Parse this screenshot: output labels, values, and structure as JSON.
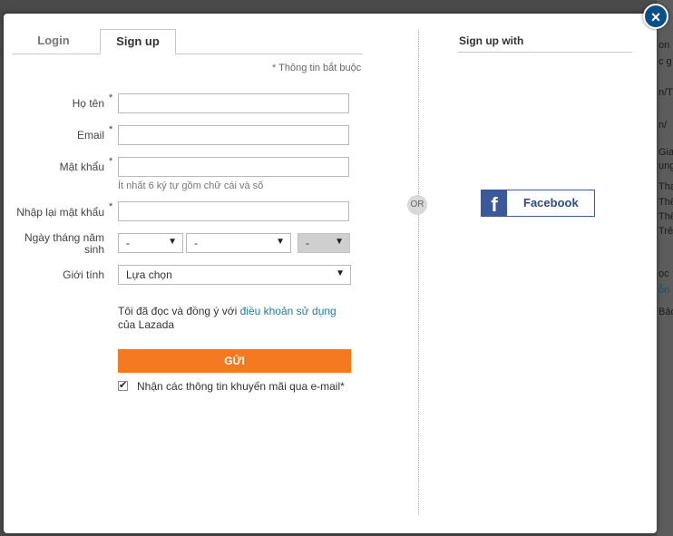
{
  "background": {
    "right_snippets": [
      "on",
      "c g",
      "n/T",
      "n/",
      "Gia",
      "ụng",
      "Tha",
      "Thể",
      "Thể",
      "Trẻ",
      "ọc",
      "ỗn",
      "Bảc"
    ]
  },
  "modal": {
    "close_label": "×",
    "tabs": [
      {
        "label": "Login"
      },
      {
        "label": "Sign up"
      }
    ],
    "required_note": "* Thông tin bắt buộc",
    "fields": {
      "name_label": "Họ tên",
      "email_label": "Email",
      "password_label": "Mật khẩu",
      "password_hint": "Ít nhất 6 ký tự gồm chữ cái và số",
      "confirm_label": "Nhập lại mật khẩu",
      "dob_label_line1": "Ngày tháng năm",
      "dob_label_line2": "sinh",
      "gender_label": "Giới tính",
      "required_star": "*"
    },
    "dob": {
      "day": "-",
      "month": "-",
      "year": "-"
    },
    "gender": {
      "selected": "Lựa chọn"
    },
    "terms": {
      "prefix": "Tôi đã đọc và đồng ý với ",
      "link": "điều khoản sử dụng",
      "suffix": " của Lazada"
    },
    "submit_label": "GỬI",
    "newsletter": {
      "checked": true,
      "check_glyph": "✔",
      "label": "Nhận các thông tin khuyến mãi qua e-mail*"
    },
    "or_label": "OR",
    "social": {
      "heading": "Sign up with",
      "facebook_icon": "f",
      "facebook_label": "Facebook"
    }
  },
  "colors": {
    "submit": "#f47920",
    "facebook": "#3b5998",
    "link": "#1c7da0",
    "close": "#0a4f8a"
  }
}
